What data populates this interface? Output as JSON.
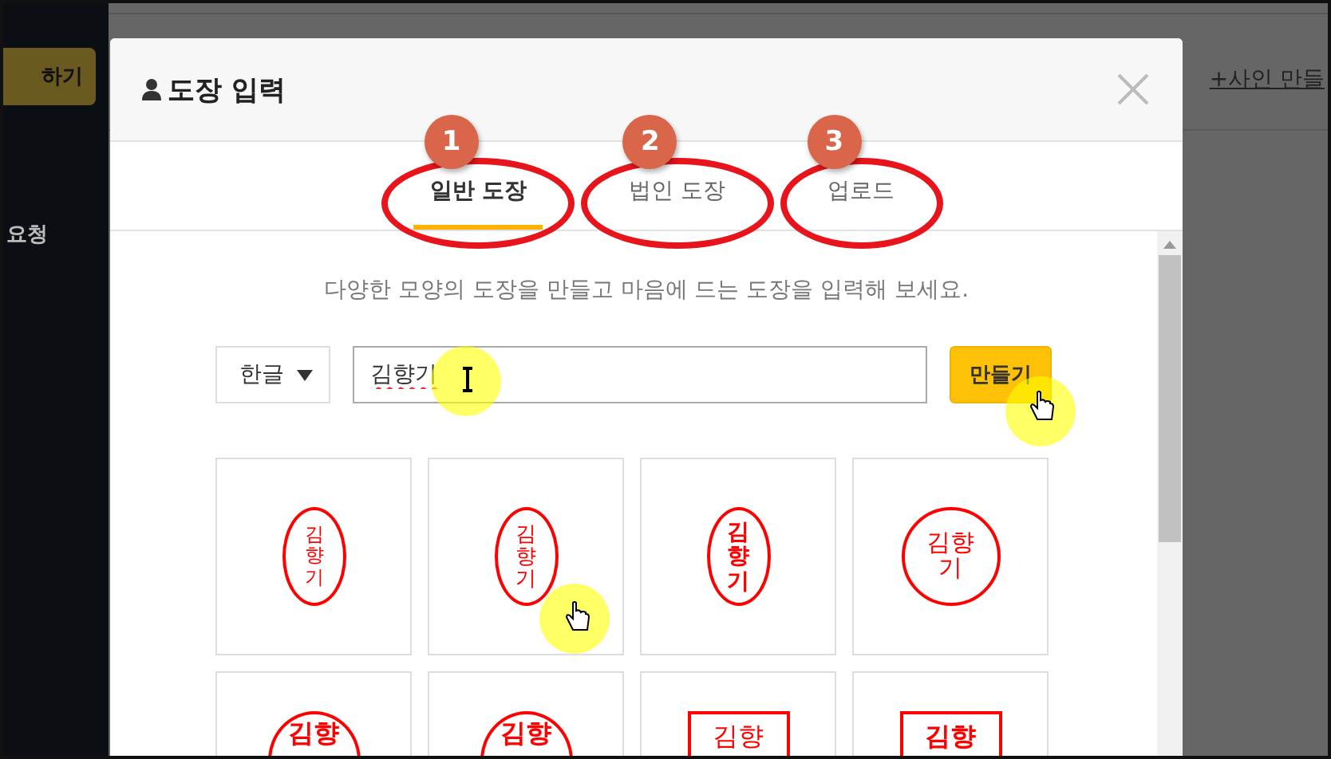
{
  "sidebar": {
    "button": "하기",
    "item": "요청"
  },
  "page": {
    "link": "+사인 만들"
  },
  "dialog": {
    "title": "도장 입력",
    "tabs": [
      {
        "label": "일반 도장",
        "selected": true,
        "badge": "1"
      },
      {
        "label": "법인 도장",
        "selected": false,
        "badge": "2"
      },
      {
        "label": "업로드",
        "selected": false,
        "badge": "3"
      }
    ],
    "description": "다양한 모양의 도장을 만들고 마음에 드는 도장을 입력해 보세요.",
    "language_select": "한글",
    "name_field": {
      "value": "김향기"
    },
    "make_button": "만들기",
    "stamps": [
      {
        "kind": "oval-seal",
        "text": "김향기"
      },
      {
        "kind": "oval",
        "text": "김향기"
      },
      {
        "kind": "oval-bold",
        "text": "김향기"
      },
      {
        "kind": "round-seal",
        "text": "김향기"
      },
      {
        "kind": "round-bold",
        "text": "김향"
      },
      {
        "kind": "round-bold",
        "text": "김향"
      },
      {
        "kind": "square",
        "text": "김향"
      },
      {
        "kind": "square-bold",
        "text": "김향"
      }
    ]
  }
}
